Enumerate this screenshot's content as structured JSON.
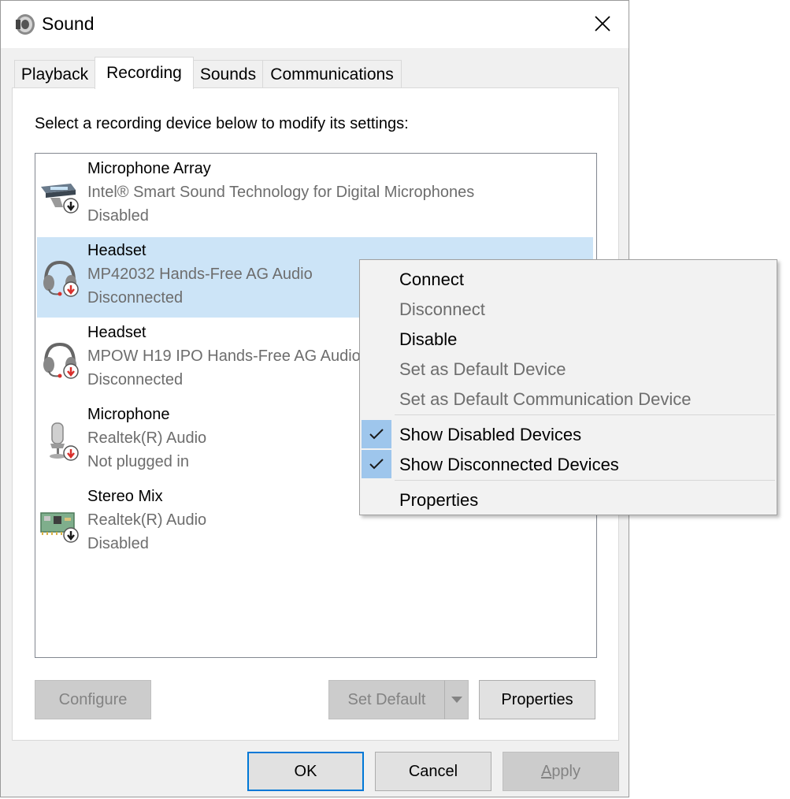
{
  "window": {
    "title": "Sound",
    "title_icon": "speaker-icon",
    "close_icon": "close-icon"
  },
  "tabs": [
    {
      "label": "Playback",
      "active": false
    },
    {
      "label": "Recording",
      "active": true
    },
    {
      "label": "Sounds",
      "active": false
    },
    {
      "label": "Communications",
      "active": false
    }
  ],
  "instructions": "Select a recording device below to modify its settings:",
  "devices": [
    {
      "name": "Microphone Array",
      "description": "Intel® Smart Sound Technology for Digital Microphones",
      "status": "Disabled",
      "icon": "microphone-array-icon",
      "badge": "disabled",
      "selected": false
    },
    {
      "name": "Headset",
      "description": "MP42032 Hands-Free AG Audio",
      "status": "Disconnected",
      "icon": "headset-icon",
      "badge": "disconnected",
      "selected": true
    },
    {
      "name": "Headset",
      "description": "MPOW H19 IPO Hands-Free AG Audio",
      "status": "Disconnected",
      "icon": "headset-icon",
      "badge": "disconnected",
      "selected": false
    },
    {
      "name": "Microphone",
      "description": "Realtek(R) Audio",
      "status": "Not plugged in",
      "icon": "microphone-icon",
      "badge": "disconnected",
      "selected": false
    },
    {
      "name": "Stereo Mix",
      "description": "Realtek(R) Audio",
      "status": "Disabled",
      "icon": "sound-card-icon",
      "badge": "disabled",
      "selected": false
    }
  ],
  "buttons": {
    "configure": "Configure",
    "set_default": "Set Default",
    "properties": "Properties",
    "ok": "OK",
    "cancel": "Cancel",
    "apply": "Apply"
  },
  "context_menu": {
    "items": [
      {
        "label": "Connect",
        "enabled": true,
        "checked": false
      },
      {
        "label": "Disconnect",
        "enabled": false,
        "checked": false
      },
      {
        "label": "Disable",
        "enabled": true,
        "checked": false
      },
      {
        "label": "Set as Default Device",
        "enabled": false,
        "checked": false
      },
      {
        "label": "Set as Default Communication Device",
        "enabled": false,
        "checked": false
      },
      {
        "label": "Show Disabled Devices",
        "enabled": true,
        "checked": true
      },
      {
        "label": "Show Disconnected Devices",
        "enabled": true,
        "checked": true
      },
      {
        "label": "Properties",
        "enabled": true,
        "checked": false
      }
    ]
  },
  "colors": {
    "selection": "#cce4f7",
    "check_highlight": "#9ec6ec",
    "focus_border": "#0078d7",
    "disconnected_badge": "#d9302c",
    "disabled_badge": "#1a1a1a"
  }
}
